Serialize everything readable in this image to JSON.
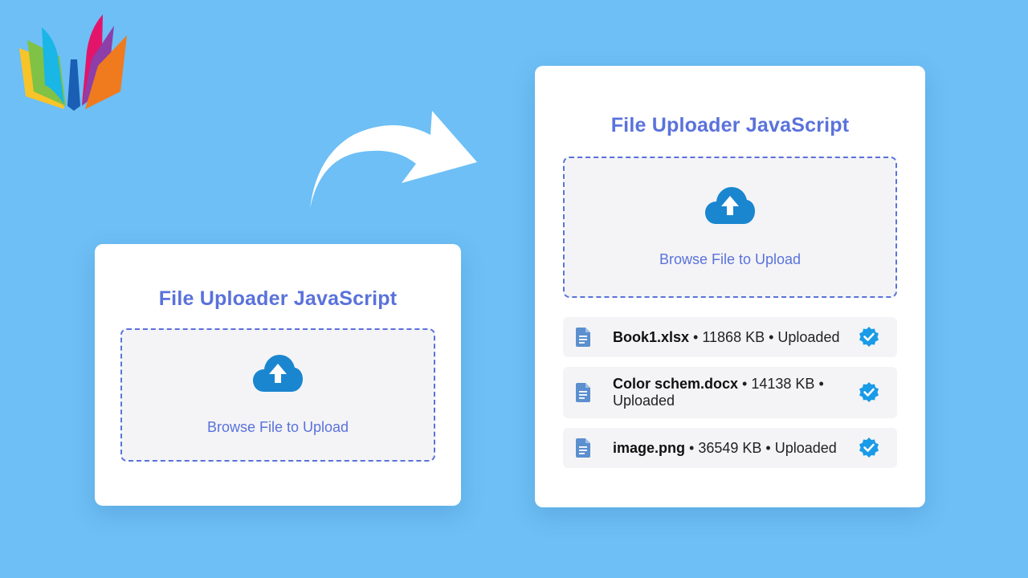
{
  "uploader_before": {
    "title": "File Uploader JavaScript",
    "browse_label": "Browse File to Upload"
  },
  "uploader_after": {
    "title": "File Uploader JavaScript",
    "browse_label": "Browse File to Upload",
    "separator": " • ",
    "files": [
      {
        "name": "Book1.xlsx",
        "size": "11868 KB",
        "status": "Uploaded"
      },
      {
        "name": "Color schem.docx",
        "size": "14138 KB",
        "status": "Uploaded"
      },
      {
        "name": "image.png",
        "size": "36549 KB",
        "status": "Uploaded"
      }
    ]
  },
  "icons": {
    "logo": "open-book-logo",
    "arrow": "curved-arrow",
    "upload": "cloud-upload-icon",
    "file": "document-icon",
    "status": "verified-check-icon"
  },
  "colors": {
    "background": "#6dbff5",
    "accent": "#5a72db",
    "cloud": "#1a86d0",
    "check": "#1a9be8",
    "file_icon": "#5b8fce",
    "panel": "#f4f4f6"
  }
}
